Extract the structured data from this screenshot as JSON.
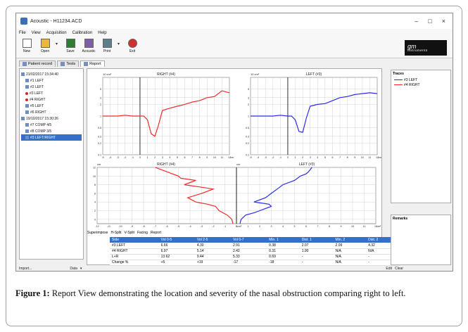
{
  "window": {
    "title": "Acoustic - H11234.ACD",
    "controls": {
      "minimize": "–",
      "maximize": "□",
      "close": "×"
    }
  },
  "menu": [
    "File",
    "View",
    "Acquisition",
    "Calibration",
    "Help"
  ],
  "toolbar": [
    {
      "label": "New",
      "icon": "new-document-icon",
      "color": "#ffffff"
    },
    {
      "label": "Open",
      "icon": "open-folder-icon",
      "color": "#e8b93c"
    },
    {
      "label": "Save",
      "icon": "save-disk-icon",
      "color": "#2e7d32"
    },
    {
      "label": "Acoustic",
      "icon": "acoustic-icon",
      "color": "#7b5ea7"
    },
    {
      "label": "Print",
      "icon": "printer-icon",
      "color": "#607d8b"
    },
    {
      "label": "Exit",
      "icon": "exit-icon",
      "color": "#d32f2f"
    }
  ],
  "logo": {
    "main": "gm",
    "sub": "instruments"
  },
  "tabs": [
    "Patient record",
    "Tests",
    "Report"
  ],
  "tree": [
    {
      "label": "21/02/2017 15:34:40",
      "level": 0,
      "marker": "folder"
    },
    {
      "label": "#1 LEFT",
      "level": 1,
      "marker": "none"
    },
    {
      "label": "#2 LEFT",
      "level": 1,
      "marker": "none"
    },
    {
      "label": "#3 LEFT",
      "level": 1,
      "marker": "dot"
    },
    {
      "label": "#4 RIGHT",
      "level": 1,
      "marker": "dot"
    },
    {
      "label": "#5 LEFT",
      "level": 1,
      "marker": "none"
    },
    {
      "label": "#6 RIGHT",
      "level": 1,
      "marker": "none"
    },
    {
      "label": "19/10/2017 15:30:26",
      "level": 0,
      "marker": "folder"
    },
    {
      "label": "#7 COMP 4/5",
      "level": 1,
      "marker": "none"
    },
    {
      "label": "#8 COMP 3/5",
      "level": 1,
      "marker": "none"
    },
    {
      "label": "#3 LEFT/RIGHT",
      "level": 1,
      "marker": "selected"
    }
  ],
  "traces_panel": {
    "title": "Traces",
    "items": [
      {
        "label": "#3 LEFT",
        "color": "#2b2bf0"
      },
      {
        "label": "#4 RIGHT",
        "color": "#f02b2b"
      }
    ]
  },
  "remarks_panel": {
    "title": "Remarks"
  },
  "subtabs": [
    "Superimpose",
    "H-Split",
    "V-Split",
    "Facing",
    "Report"
  ],
  "table": {
    "headers": [
      "Side",
      "Vol 0-5",
      "Vol 2-5",
      "Vol 0-7",
      "Min. 1",
      "Dist. 1",
      "Min. 2",
      "Dist. 2"
    ],
    "rows": [
      [
        "#3 LEFT",
        "6.66",
        "4.30",
        "2.91",
        "0.38",
        "2.07",
        "2.09",
        "4.32"
      ],
      [
        "#4 RIGHT",
        "6.97",
        "5.14",
        "2.42",
        "0.31",
        "1.90",
        "N/A",
        "N/A"
      ],
      [
        "L+R",
        "13.62",
        "9.44",
        "5.33",
        "0.69",
        "-",
        "N/A",
        "-"
      ],
      [
        "Change %",
        "+5",
        "+19",
        "-17",
        "-18",
        "-",
        "N/A",
        "-"
      ]
    ]
  },
  "status": {
    "left": "Import...",
    "data_label": "Data",
    "edit": "Edit",
    "clear": "Clear"
  },
  "caption": {
    "label": "Figure 1:",
    "text": " Report View demonstrating the location and severity of the nasal obstruction comparing right to left."
  },
  "chart_data": [
    {
      "type": "line",
      "title": "RIGHT (#4)",
      "ylabel": "10 cm²",
      "xlabel": "cm",
      "y_scale": "log",
      "ylim": [
        0.1,
        10
      ],
      "xlim": [
        -5,
        12
      ],
      "x_ticks": [
        -5,
        -4,
        -3,
        -2,
        -1,
        0,
        1,
        2,
        3,
        4,
        5,
        6,
        7,
        8,
        9,
        10,
        11,
        12
      ],
      "y_ticks": [
        "10 cm²",
        "5",
        "3",
        "2",
        "1",
        "0.5",
        "0.3",
        "0.2",
        "0.1"
      ],
      "series": [
        {
          "name": "#4 RIGHT",
          "color": "#f02b2b",
          "x": [
            -5,
            -4,
            -3,
            -2,
            -1,
            0,
            0.5,
            1,
            1.5,
            2,
            2.5,
            3,
            4,
            5,
            6,
            7,
            8,
            9,
            10,
            11,
            12
          ],
          "y": [
            1,
            1,
            1,
            1.05,
            1,
            1,
            1,
            0.8,
            0.35,
            0.3,
            0.6,
            1.4,
            1.6,
            1.8,
            2.0,
            2.3,
            2.5,
            3.0,
            3.2,
            4.5,
            4.0
          ]
        }
      ]
    },
    {
      "type": "line",
      "title": "LEFT (#3)",
      "ylabel": "10 cm²",
      "xlabel": "cm",
      "y_scale": "log",
      "ylim": [
        0.1,
        10
      ],
      "xlim": [
        -5,
        12
      ],
      "x_ticks": [
        -5,
        -4,
        -3,
        -2,
        -1,
        0,
        1,
        2,
        3,
        4,
        5,
        6,
        7,
        8,
        9,
        10,
        11,
        12
      ],
      "y_ticks": [
        "10 cm²",
        "5",
        "3",
        "2",
        "1",
        "0.5",
        "0.3",
        "0.2",
        "0.1"
      ],
      "series": [
        {
          "name": "#3 LEFT",
          "color": "#2b2bf0",
          "x": [
            -5,
            -4,
            -3,
            -2,
            -1,
            0,
            0.5,
            1,
            1.5,
            2,
            2.5,
            3,
            4,
            5,
            6,
            7,
            8,
            9,
            10,
            11,
            12
          ],
          "y": [
            1,
            1,
            1,
            1,
            1.05,
            1,
            1,
            0.8,
            0.4,
            0.38,
            0.9,
            1.8,
            2.0,
            2.1,
            2.5,
            3.0,
            3.2,
            3.6,
            3.8,
            4.0,
            3.8
          ]
        }
      ]
    },
    {
      "type": "line",
      "title": "RIGHT (#4)",
      "ylabel": "cm",
      "xlabel": "cm²",
      "orientation": "vertical",
      "xlim": [
        -12,
        0
      ],
      "ylim": [
        -1,
        12
      ],
      "x_ticks": [
        -12,
        -11,
        -10,
        -9,
        -8,
        -7,
        -6,
        -5,
        -4,
        -3,
        -2,
        -1,
        0
      ],
      "y_ticks": [
        12,
        10,
        8,
        6,
        4,
        2,
        0
      ],
      "series": [
        {
          "name": "#4 RIGHT",
          "color": "#f02b2b",
          "x": [
            -0.3,
            -0.4,
            -0.8,
            -1.5,
            -1.8,
            -2.5,
            -3.5,
            -4.2,
            -3.0,
            -2.0,
            -3.2,
            -4.5,
            -3.5,
            -4.8,
            -5.0,
            -6.0,
            -6.5,
            -7.0
          ],
          "y": [
            -1,
            0,
            1,
            2,
            3,
            3.5,
            4,
            5,
            6,
            7,
            7.5,
            8,
            9,
            9.5,
            10,
            11,
            11.5,
            12
          ]
        }
      ]
    },
    {
      "type": "line",
      "title": "LEFT (#3)",
      "ylabel": "cm",
      "xlabel": "cm²",
      "orientation": "vertical",
      "xlim": [
        0,
        12
      ],
      "ylim": [
        -1,
        12
      ],
      "x_ticks": [
        0,
        1,
        2,
        3,
        4,
        5,
        6,
        7,
        8,
        9,
        10,
        11,
        12
      ],
      "y_ticks": [
        12,
        10,
        8,
        6,
        4,
        2,
        0
      ],
      "series": [
        {
          "name": "#3 LEFT",
          "color": "#2b2bf0",
          "x": [
            0.3,
            0.4,
            0.8,
            1.5,
            2.0,
            3.0,
            2.8,
            1.5,
            2.5,
            3.0,
            3.5,
            4.0,
            5.0,
            5.5,
            6.0,
            6.2,
            6.5
          ],
          "y": [
            -1,
            0,
            1,
            1.5,
            2,
            3,
            3.5,
            4,
            5,
            6,
            7,
            8,
            9,
            10,
            10.5,
            11,
            12
          ]
        }
      ]
    }
  ]
}
